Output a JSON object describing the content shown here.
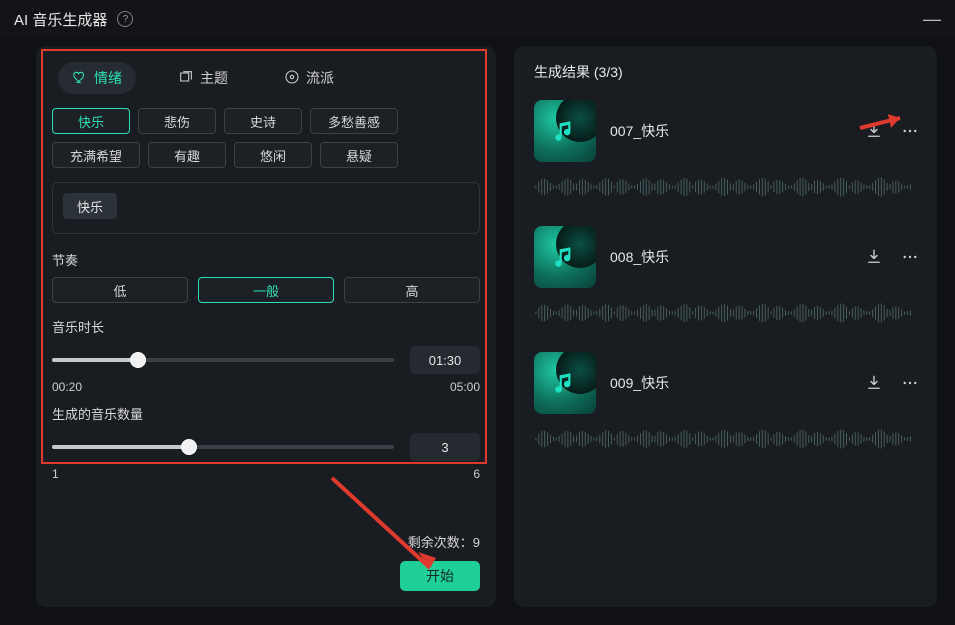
{
  "titlebar": {
    "title": "AI 音乐生成器"
  },
  "tabs": {
    "mood": {
      "label": "情绪"
    },
    "theme": {
      "label": "主题"
    },
    "genre": {
      "label": "流派"
    }
  },
  "mood_options": {
    "happy": "快乐",
    "sad": "悲伤",
    "epic": "史诗",
    "sentimental": "多愁善感",
    "hopeful": "充满希望",
    "fun": "有趣",
    "relaxed": "悠闲",
    "suspense": "悬疑"
  },
  "selected_tag": "快乐",
  "tempo": {
    "label": "节奏",
    "low": "低",
    "mid": "一般",
    "high": "高"
  },
  "duration": {
    "label": "音乐时长",
    "value": "01:30",
    "min": "00:20",
    "max": "05:00",
    "percent": 25
  },
  "count": {
    "label": "生成的音乐数量",
    "value": "3",
    "min": "1",
    "max": "6",
    "percent": 40
  },
  "remaining": {
    "label": "剩余次数：",
    "value": "9"
  },
  "start_btn": "开始",
  "results": {
    "title_prefix": "生成结果 ",
    "title_count": "(3/3)",
    "items": [
      {
        "name": "007_快乐"
      },
      {
        "name": "008_快乐"
      },
      {
        "name": "009_快乐"
      }
    ]
  }
}
